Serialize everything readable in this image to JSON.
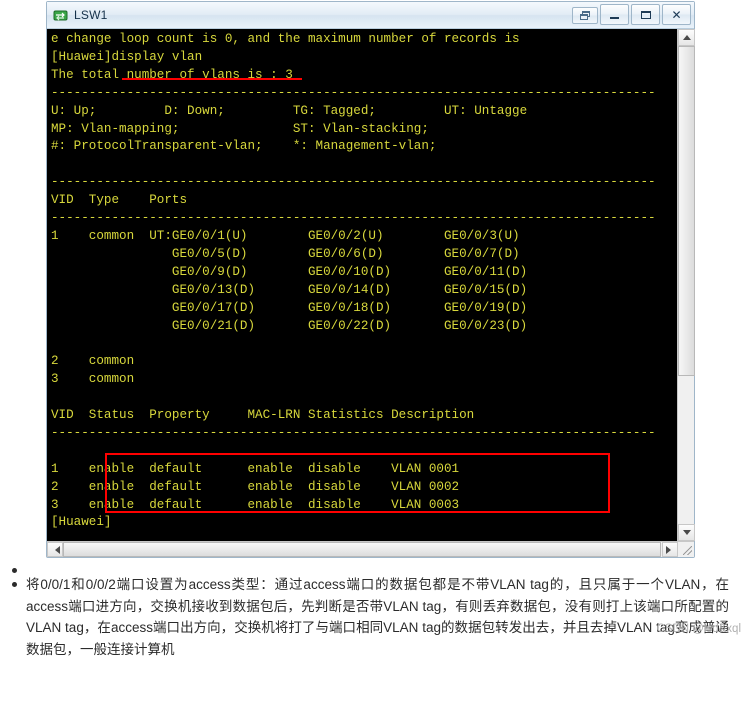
{
  "window": {
    "title": "LSW1",
    "icon": "switch-icon",
    "buttons": {
      "restore_small": "restore-icon",
      "minimize": "_",
      "maximize": "maximize-icon",
      "close": "X"
    }
  },
  "console": {
    "lines": [
      "e change loop count is 0, and the maximum number of records is",
      "[Huawei]display vlan",
      "The total number of vlans is : 3",
      "--------------------------------------------------------------------------------",
      "U: Up;         D: Down;         TG: Tagged;         UT: Untagge",
      "MP: Vlan-mapping;               ST: Vlan-stacking;",
      "#: ProtocolTransparent-vlan;    *: Management-vlan;",
      "",
      "--------------------------------------------------------------------------------",
      "VID  Type    Ports",
      "--------------------------------------------------------------------------------",
      "1    common  UT:GE0/0/1(U)        GE0/0/2(U)        GE0/0/3(U)",
      "                GE0/0/5(D)        GE0/0/6(D)        GE0/0/7(D)",
      "                GE0/0/9(D)        GE0/0/10(D)       GE0/0/11(D)",
      "                GE0/0/13(D)       GE0/0/14(D)       GE0/0/15(D)",
      "                GE0/0/17(D)       GE0/0/18(D)       GE0/0/19(D)",
      "                GE0/0/21(D)       GE0/0/22(D)       GE0/0/23(D)",
      "",
      "2    common",
      "3    common",
      "",
      "VID  Status  Property     MAC-LRN Statistics Description",
      "--------------------------------------------------------------------------------",
      "",
      "1    enable  default      enable  disable    VLAN 0001",
      "2    enable  default      enable  disable    VLAN 0002",
      "3    enable  default      enable  disable    VLAN 0003",
      "[Huawei]"
    ],
    "text_color": "#d8d83c",
    "background_color": "#000000",
    "highlight_color": "#ff0000"
  },
  "notes": {
    "bullet1": "",
    "bullet2": "将0/0/1和0/0/2端口设置为access类型：通过access端口的数据包都是不带VLAN tag的，且只属于一个VLAN，在access端口进方向，交换机接收到数据包后，先判断是否带VLAN tag，有则丢弃数据包，没有则打上该端口所配置的VLAN tag，在access端口出方向，交换机将打了与端口相同VLAN tag的数据包转发出去，并且去掉VLAN tag变成普通数据包，一般连接计算机",
    "watermark": "CSDN @lsd&xql"
  }
}
